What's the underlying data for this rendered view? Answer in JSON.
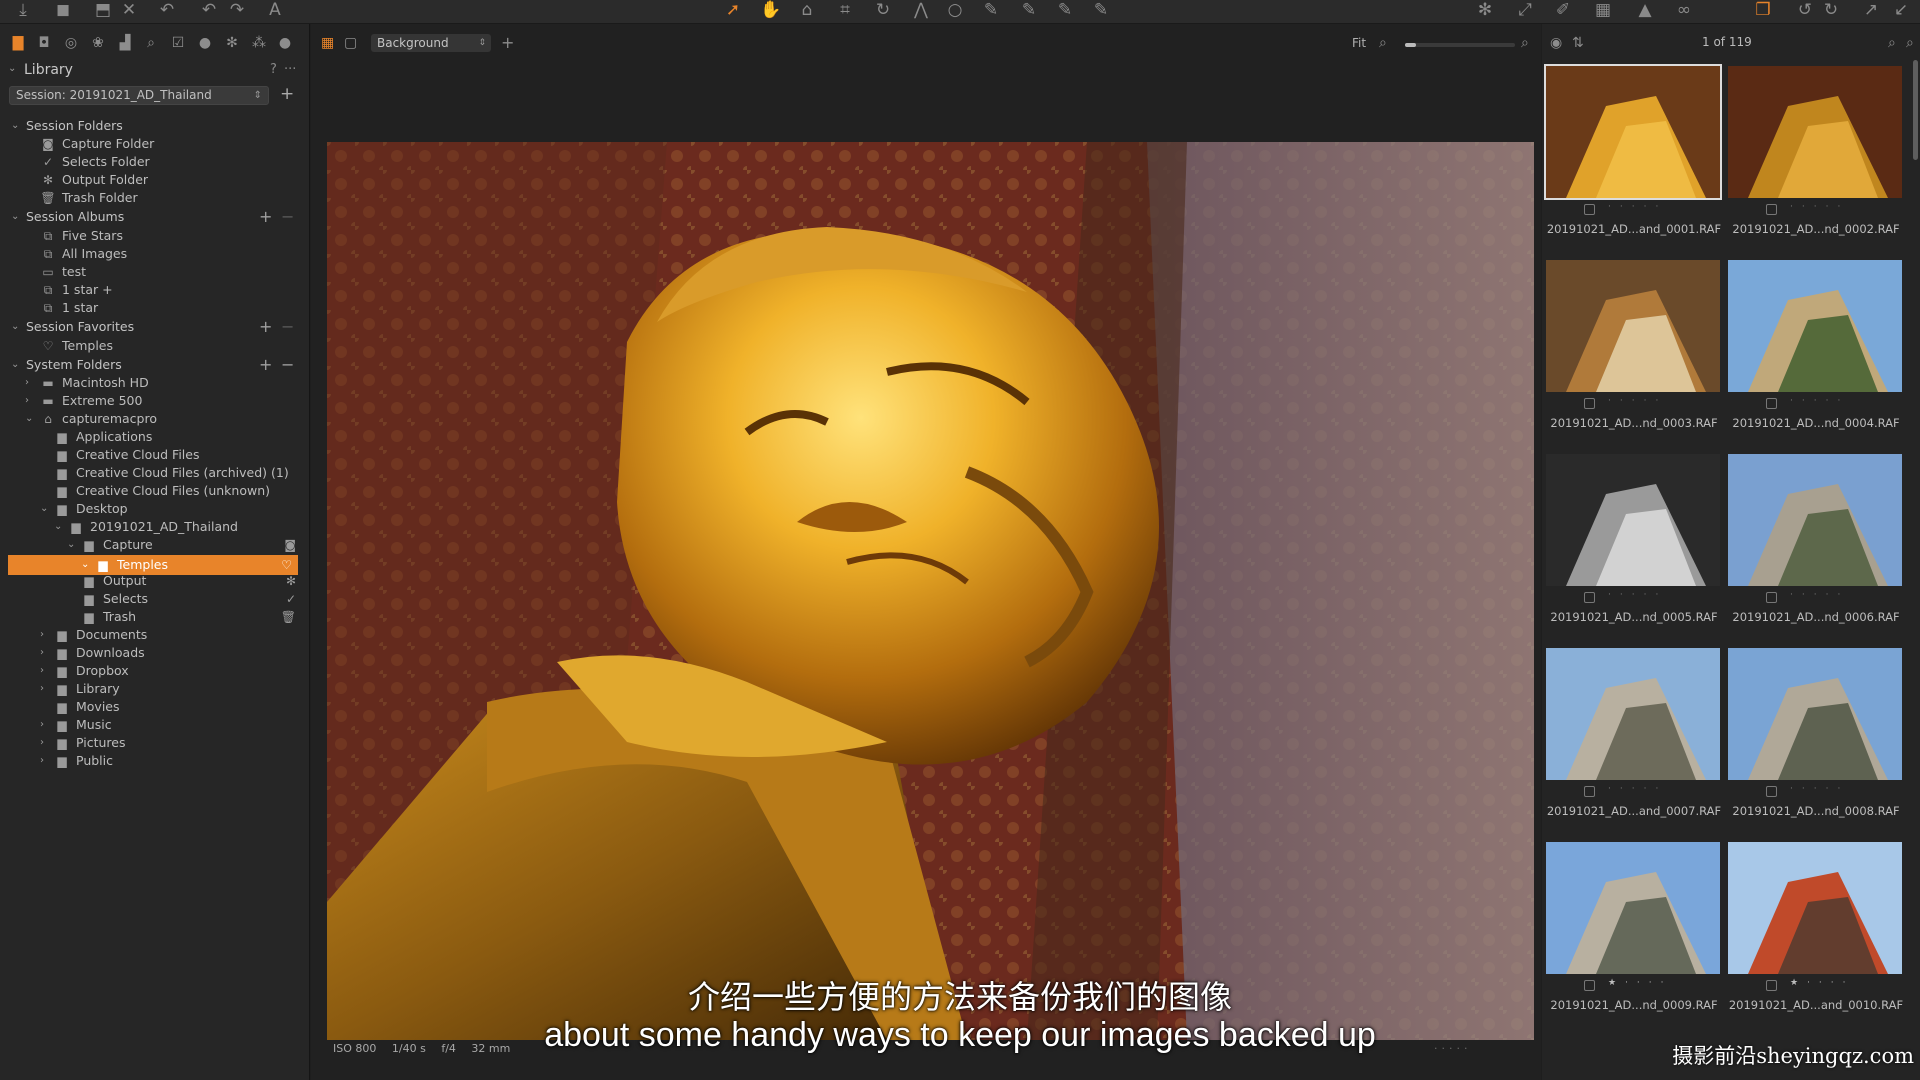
{
  "toolbar": {
    "left_icons": [
      "import-icon",
      "camera-icon",
      "export-icon",
      "delete-icon",
      "undo-icon",
      "undo-alt-icon",
      "redo-icon",
      "text-icon"
    ],
    "center_icons": [
      "pointer-icon",
      "pan-icon",
      "loupe-icon",
      "crop-icon",
      "rotate-icon",
      "keystone-icon",
      "spot-icon",
      "brush-icon",
      "eraser-icon",
      "gradient-icon",
      "picker-icon"
    ],
    "right_icons": [
      "settings-icon",
      "expand-icon",
      "edit-icon",
      "grid-icon",
      "warning-icon",
      "proof-icon",
      "layers-icon",
      "reset-icon",
      "redo-tool-icon",
      "copy-icon",
      "paste-icon"
    ]
  },
  "library": {
    "title": "Library",
    "help": "?",
    "more": "···",
    "session": "Session: 20191021_AD_Thailand",
    "add_label": "+"
  },
  "tree": {
    "session_folders": {
      "label": "Session Folders",
      "items": [
        "Capture Folder",
        "Selects Folder",
        "Output Folder",
        "Trash Folder"
      ]
    },
    "session_albums": {
      "label": "Session Albums",
      "items": [
        "Five Stars",
        "All Images",
        "test",
        "1 star +",
        "1 star"
      ]
    },
    "session_favorites": {
      "label": "Session Favorites",
      "items": [
        "Temples"
      ]
    },
    "system_folders": {
      "label": "System Folders",
      "items": [
        "Macintosh HD",
        "Extreme 500",
        "capturemacpro",
        "Applications",
        "Creative Cloud Files",
        "Creative Cloud Files (archived) (1)",
        "Creative Cloud Files (unknown)",
        "Desktop",
        "20191021_AD_Thailand",
        "Capture",
        "Temples",
        "Output",
        "Selects",
        "Trash",
        "Documents",
        "Downloads",
        "Dropbox",
        "Library",
        "Movies",
        "Music",
        "Pictures",
        "Public"
      ]
    }
  },
  "viewer": {
    "style": "Background",
    "fit": "Fit",
    "zoom_level": 0.1,
    "exif": {
      "iso": "ISO 800",
      "shutter": "1/40 s",
      "aperture": "f/4",
      "focal": "32 mm"
    }
  },
  "browser": {
    "count": "1 of 119",
    "thumbnails": [
      {
        "name": "20191021_AD...and_0001.RAF",
        "stars": 0,
        "selected": true
      },
      {
        "name": "20191021_AD...nd_0002.RAF",
        "stars": 0
      },
      {
        "name": "20191021_AD...nd_0003.RAF",
        "stars": 0
      },
      {
        "name": "20191021_AD...nd_0004.RAF",
        "stars": 0
      },
      {
        "name": "20191021_AD...nd_0005.RAF",
        "stars": 0
      },
      {
        "name": "20191021_AD...nd_0006.RAF",
        "stars": 0
      },
      {
        "name": "20191021_AD...and_0007.RAF",
        "stars": 0
      },
      {
        "name": "20191021_AD...nd_0008.RAF",
        "stars": 0
      },
      {
        "name": "20191021_AD...nd_0009.RAF",
        "stars": 1
      },
      {
        "name": "20191021_AD...and_0010.RAF",
        "stars": 1
      }
    ]
  },
  "subtitles": {
    "zh": "介绍一些方便的方法来备份我们的图像",
    "en": "about some handy ways to keep our images backed up"
  },
  "watermark": "摄影前沿sheyingqz.com",
  "colors": {
    "accent": "#e8842a",
    "panel": "#262626",
    "viewer": "#212121"
  }
}
